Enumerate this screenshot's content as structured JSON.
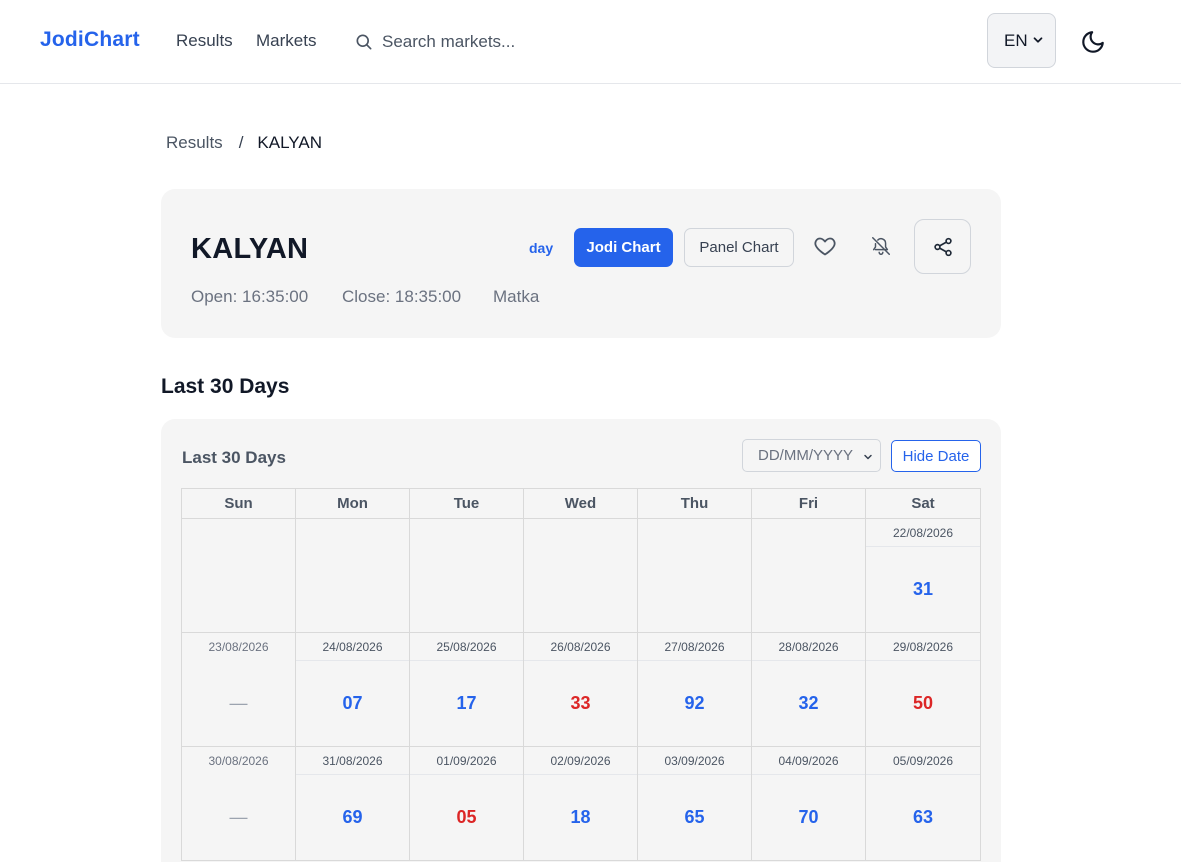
{
  "header": {
    "brand": "JodiChart",
    "nav": {
      "results": "Results",
      "markets": "Markets"
    },
    "search_placeholder": "Search markets...",
    "language": "EN"
  },
  "breadcrumb": {
    "parent": "Results",
    "separator": "/",
    "current": "KALYAN"
  },
  "market": {
    "name": "KALYAN",
    "tag": "day",
    "jodi_chart_label": "Jodi Chart",
    "panel_chart_label": "Panel Chart",
    "open": "Open: 16:35:00",
    "close": "Close: 18:35:00",
    "type": "Matka"
  },
  "section_title": "Last 30 Days",
  "calendar": {
    "title": "Last 30 Days",
    "date_placeholder": "DD/MM/YYYY",
    "hide_date_label": "Hide Date",
    "weekdays": [
      "Sun",
      "Mon",
      "Tue",
      "Wed",
      "Thu",
      "Fri",
      "Sat"
    ],
    "weeks": [
      [
        {
          "date": "",
          "value": ""
        },
        {
          "date": "",
          "value": ""
        },
        {
          "date": "",
          "value": ""
        },
        {
          "date": "",
          "value": ""
        },
        {
          "date": "",
          "value": ""
        },
        {
          "date": "",
          "value": ""
        },
        {
          "date": "22/08/2026",
          "value": "31",
          "color": "blue"
        }
      ],
      [
        {
          "date": "23/08/2026",
          "value": "—",
          "color": "gray"
        },
        {
          "date": "24/08/2026",
          "value": "07",
          "color": "blue"
        },
        {
          "date": "25/08/2026",
          "value": "17",
          "color": "blue"
        },
        {
          "date": "26/08/2026",
          "value": "33",
          "color": "red"
        },
        {
          "date": "27/08/2026",
          "value": "92",
          "color": "blue"
        },
        {
          "date": "28/08/2026",
          "value": "32",
          "color": "blue"
        },
        {
          "date": "29/08/2026",
          "value": "50",
          "color": "red"
        }
      ],
      [
        {
          "date": "30/08/2026",
          "value": "—",
          "color": "gray"
        },
        {
          "date": "31/08/2026",
          "value": "69",
          "color": "blue"
        },
        {
          "date": "01/09/2026",
          "value": "05",
          "color": "red"
        },
        {
          "date": "02/09/2026",
          "value": "18",
          "color": "blue"
        },
        {
          "date": "03/09/2026",
          "value": "65",
          "color": "blue"
        },
        {
          "date": "04/09/2026",
          "value": "70",
          "color": "blue"
        },
        {
          "date": "05/09/2026",
          "value": "63",
          "color": "blue"
        }
      ]
    ]
  },
  "colors": {
    "accent": "#2563eb",
    "red": "#dc2626"
  },
  "icons": [
    "search-icon",
    "chevron-down-icon",
    "moon-icon",
    "heart-icon",
    "bell-off-icon",
    "share-icon"
  ]
}
